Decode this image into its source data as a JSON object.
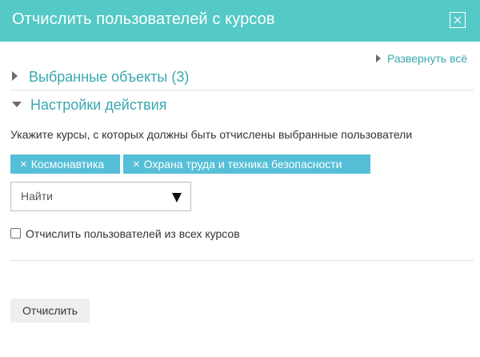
{
  "dialog": {
    "title": "Отчислить пользователей с курсов",
    "close_icon": "close-icon"
  },
  "expand_all_label": "Развернуть всё",
  "sections": {
    "selected": {
      "label": "Выбранные объекты (3)",
      "expanded": false
    },
    "settings": {
      "label": "Настройки действия",
      "expanded": true
    }
  },
  "settings": {
    "instructions": "Укажите курсы, с которых должны быть отчислены выбранные пользователи",
    "selected_courses": [
      {
        "label": "Космонавтика",
        "remove_icon": "×"
      },
      {
        "label": "Охрана труда и техника безопасности",
        "remove_icon": "×"
      }
    ],
    "search": {
      "placeholder": "Найти"
    },
    "unenrol_all": {
      "label": "Отчислить пользователей из всех курсов",
      "checked": false
    }
  },
  "submit_label": "Отчислить",
  "colors": {
    "header": "#54c9c6",
    "link": "#3aa8b0",
    "tag": "#56bfd8",
    "button": "#efefef"
  }
}
